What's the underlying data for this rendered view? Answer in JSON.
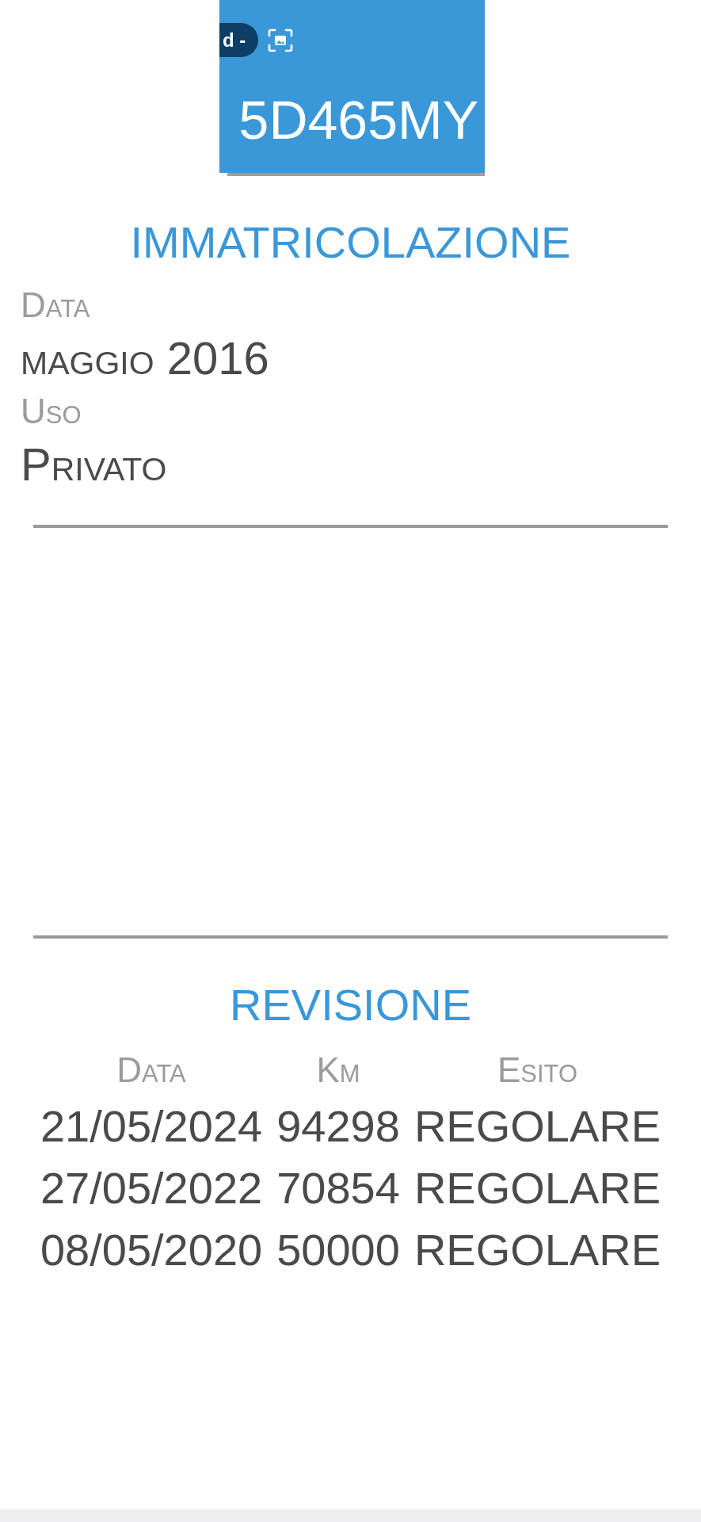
{
  "header": {
    "badge": "d -",
    "plate": "5D465MY"
  },
  "registration": {
    "title": "IMMATRICOLAZIONE",
    "fields": [
      {
        "label": "Data",
        "value": "maggio 2016"
      },
      {
        "label": "Uso",
        "value": "Privato"
      }
    ]
  },
  "inspection": {
    "title": "REVISIONE",
    "columns": [
      "Data",
      "Km",
      "Esito"
    ],
    "rows": [
      [
        "21/05/2024",
        "94298",
        "REGOLARE"
      ],
      [
        "27/05/2022",
        "70854",
        "REGOLARE"
      ],
      [
        "08/05/2020",
        "50000",
        "REGOLARE"
      ]
    ]
  }
}
